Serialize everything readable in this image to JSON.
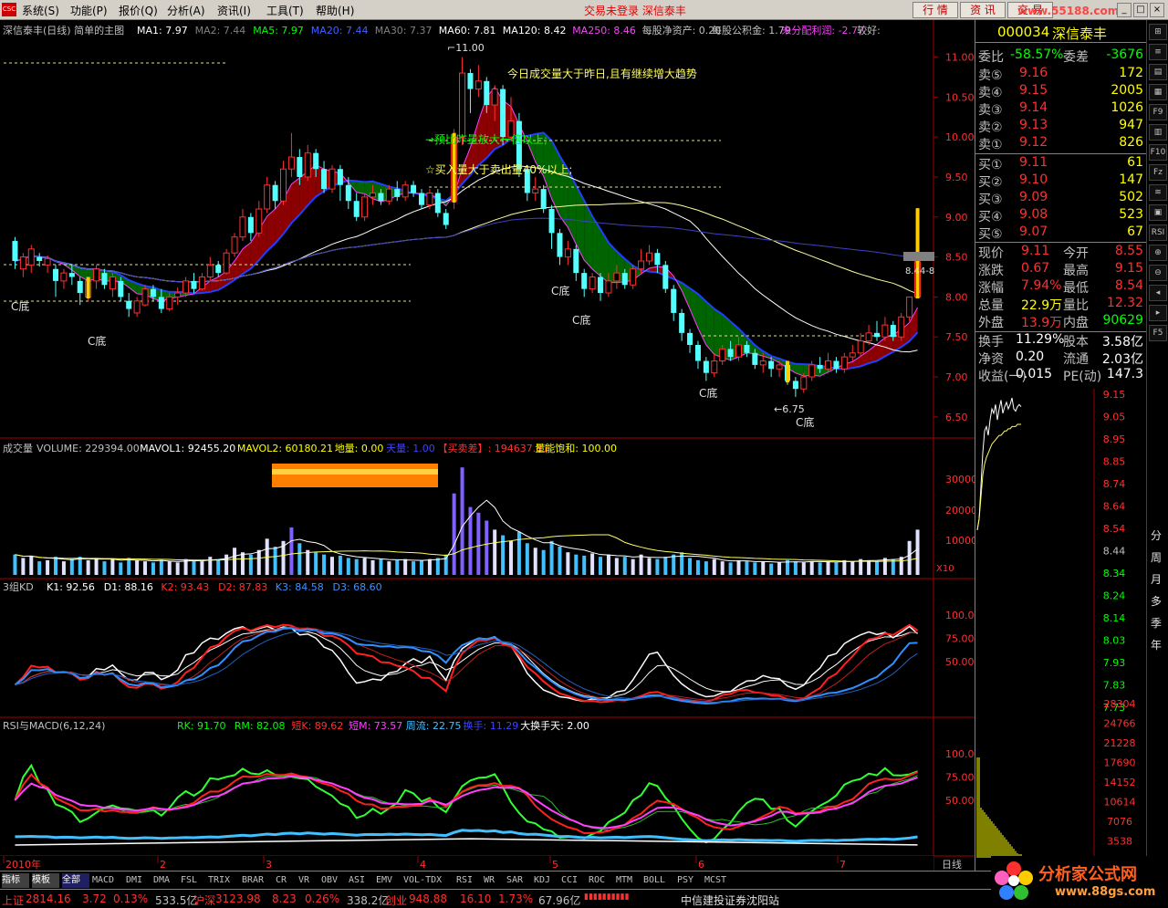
{
  "menu": {
    "items": [
      "系统(S)",
      "功能(P)",
      "报价(Q)",
      "分析(A)",
      "资讯(I)",
      "工具(T)",
      "帮助(H)"
    ],
    "alert": "交易未登录 深信泰丰",
    "buttons": [
      "行 情",
      "资 讯",
      "交 易"
    ],
    "watermark": "www.55188.com"
  },
  "main": {
    "title": "深信泰丰(日线) 简单的主图",
    "ma": [
      {
        "label": "MA1: 7.97",
        "color": "#ffffff"
      },
      {
        "label": "MA2: 7.44",
        "color": "#808080"
      },
      {
        "label": "MA5: 7.97",
        "color": "#00ff00"
      },
      {
        "label": "MA20: 7.44",
        "color": "#4060ff"
      },
      {
        "label": "MA30: 7.37",
        "color": "#808080"
      },
      {
        "label": "MA60: 7.81",
        "color": "#ffffff"
      },
      {
        "label": "MA120: 8.42",
        "color": "#ffffff"
      },
      {
        "label": "MA250: 8.46",
        "color": "#ff40ff"
      },
      {
        "label": "每股净资产: 0.20",
        "color": "#c0c0c0"
      },
      {
        "label": "每股公积金: 1.79",
        "color": "#c0c0c0"
      },
      {
        "label": "未分配利润: -2.77",
        "color": "#ff40ff"
      },
      {
        "label": "较好:",
        "color": "#c0c0c0"
      }
    ],
    "annotations": {
      "trend": "今日成交量大于昨日,且有继续增大趋势",
      "vol_double": "→预比昨量放大一倍以上;",
      "buy_more": "☆买入量大于卖出量40%以上;",
      "high": "11.00",
      "low": "←6.75",
      "current": "8.44-8",
      "cbottom": "C底"
    },
    "price_ticks": [
      "11.00",
      "10.50",
      "10.00",
      "9.50",
      "9.00",
      "8.50",
      "8.00",
      "7.50",
      "7.00",
      "6.50"
    ],
    "candles": [
      [
        8.7,
        8.45,
        8.75,
        8.35
      ],
      [
        8.35,
        8.5,
        8.55,
        8.25
      ],
      [
        8.4,
        8.6,
        8.65,
        8.3
      ],
      [
        8.5,
        8.45,
        8.55,
        8.38
      ],
      [
        8.4,
        8.48,
        8.52,
        8.3
      ],
      [
        8.35,
        8.2,
        8.4,
        8.0
      ],
      [
        8.2,
        8.3,
        8.35,
        8.1
      ],
      [
        8.3,
        8.25,
        8.4,
        8.15
      ],
      [
        8.2,
        8.05,
        8.25,
        7.9
      ],
      [
        8.0,
        8.2,
        8.25,
        7.95
      ],
      [
        8.2,
        8.35,
        8.4,
        8.1
      ],
      [
        8.3,
        8.15,
        8.35,
        8.1
      ],
      [
        8.1,
        8.25,
        8.3,
        8.0
      ],
      [
        8.2,
        8.0,
        8.25,
        7.95
      ],
      [
        7.95,
        7.85,
        8.05,
        7.75
      ],
      [
        7.8,
        7.95,
        8.0,
        7.75
      ],
      [
        7.9,
        8.1,
        8.15,
        7.88
      ],
      [
        8.1,
        8.0,
        8.15,
        7.95
      ],
      [
        8.0,
        7.85,
        8.1,
        7.8
      ],
      [
        7.85,
        8.0,
        8.05,
        7.82
      ],
      [
        8.0,
        8.05,
        8.12,
        7.9
      ],
      [
        8.05,
        8.2,
        8.25,
        8.0
      ],
      [
        8.2,
        8.1,
        8.3,
        8.05
      ],
      [
        8.1,
        8.25,
        8.3,
        8.08
      ],
      [
        8.25,
        8.4,
        8.5,
        8.2
      ],
      [
        8.4,
        8.3,
        8.45,
        8.25
      ],
      [
        8.3,
        8.55,
        8.6,
        8.28
      ],
      [
        8.55,
        8.75,
        8.8,
        8.5
      ],
      [
        8.75,
        9.0,
        9.1,
        8.7
      ],
      [
        9.0,
        8.8,
        9.05,
        8.7
      ],
      [
        8.8,
        9.1,
        9.2,
        8.75
      ],
      [
        9.1,
        9.4,
        9.5,
        9.05
      ],
      [
        9.4,
        9.2,
        9.45,
        9.1
      ],
      [
        9.2,
        9.6,
        9.7,
        9.15
      ],
      [
        9.6,
        9.75,
        10.05,
        9.5
      ],
      [
        9.75,
        9.5,
        9.85,
        9.4
      ],
      [
        9.5,
        9.8,
        9.9,
        9.45
      ],
      [
        9.8,
        9.6,
        9.85,
        9.5
      ],
      [
        9.6,
        9.35,
        9.7,
        9.3
      ],
      [
        9.35,
        9.6,
        9.65,
        9.3
      ],
      [
        9.6,
        9.4,
        9.65,
        9.2
      ],
      [
        9.4,
        9.2,
        9.5,
        9.1
      ],
      [
        9.2,
        9.0,
        9.3,
        8.95
      ],
      [
        9.0,
        9.25,
        9.3,
        8.95
      ],
      [
        9.25,
        9.3,
        9.4,
        9.15
      ],
      [
        9.3,
        9.2,
        9.35,
        9.15
      ],
      [
        9.2,
        9.35,
        9.4,
        9.15
      ],
      [
        9.35,
        9.25,
        9.45,
        9.2
      ],
      [
        9.25,
        9.4,
        9.45,
        9.2
      ],
      [
        9.4,
        9.3,
        9.45,
        9.25
      ],
      [
        9.3,
        9.15,
        9.35,
        9.1
      ],
      [
        9.15,
        9.3,
        9.35,
        9.1
      ],
      [
        9.3,
        9.05,
        9.35,
        9.0
      ],
      [
        9.05,
        8.9,
        9.1,
        8.85
      ],
      [
        9.2,
        10.0,
        10.1,
        9.1
      ],
      [
        10.0,
        10.8,
        11.0,
        9.9
      ],
      [
        10.8,
        10.6,
        10.85,
        10.3
      ],
      [
        10.6,
        10.7,
        10.9,
        10.5
      ],
      [
        10.7,
        10.4,
        10.75,
        10.3
      ],
      [
        10.4,
        10.6,
        10.65,
        10.2
      ],
      [
        10.6,
        10.0,
        10.65,
        9.9
      ],
      [
        10.0,
        10.2,
        10.5,
        9.95
      ],
      [
        10.2,
        9.6,
        10.3,
        9.5
      ],
      [
        9.6,
        9.3,
        9.65,
        9.2
      ],
      [
        9.3,
        9.35,
        9.5,
        9.2
      ],
      [
        9.35,
        9.1,
        9.4,
        9.05
      ],
      [
        9.1,
        8.8,
        9.15,
        8.6
      ],
      [
        8.8,
        8.5,
        8.85,
        8.4
      ],
      [
        8.5,
        8.6,
        8.7,
        8.4
      ],
      [
        8.6,
        8.3,
        8.65,
        8.2
      ],
      [
        8.3,
        8.1,
        8.35,
        8.0
      ],
      [
        8.1,
        8.25,
        8.3,
        8.05
      ],
      [
        8.25,
        8.05,
        8.3,
        7.95
      ],
      [
        8.05,
        8.2,
        8.3,
        8.0
      ],
      [
        8.2,
        8.3,
        8.4,
        8.1
      ],
      [
        8.3,
        8.15,
        8.35,
        8.1
      ],
      [
        8.15,
        8.35,
        8.4,
        8.1
      ],
      [
        8.35,
        8.45,
        8.6,
        8.3
      ],
      [
        8.45,
        8.55,
        8.65,
        8.4
      ],
      [
        8.55,
        8.4,
        8.6,
        8.3
      ],
      [
        8.4,
        8.1,
        8.45,
        8.05
      ],
      [
        8.1,
        7.8,
        8.15,
        7.7
      ],
      [
        7.8,
        7.55,
        7.85,
        7.45
      ],
      [
        7.55,
        7.4,
        7.6,
        7.3
      ],
      [
        7.4,
        7.2,
        7.45,
        7.1
      ],
      [
        7.2,
        7.05,
        7.25,
        6.95
      ],
      [
        7.05,
        7.2,
        7.3,
        7.0
      ],
      [
        7.2,
        7.35,
        7.4,
        7.15
      ],
      [
        7.35,
        7.25,
        7.45,
        7.2
      ],
      [
        7.25,
        7.4,
        7.5,
        7.2
      ],
      [
        7.4,
        7.3,
        7.45,
        7.25
      ],
      [
        7.3,
        7.15,
        7.35,
        7.1
      ],
      [
        7.15,
        7.2,
        7.3,
        7.05
      ],
      [
        7.2,
        7.1,
        7.25,
        7.0
      ],
      [
        7.1,
        7.15,
        7.2,
        7.0
      ],
      [
        7.15,
        6.95,
        7.2,
        6.9
      ],
      [
        6.95,
        6.85,
        7.0,
        6.75
      ],
      [
        6.85,
        7.0,
        7.05,
        6.8
      ],
      [
        7.0,
        7.15,
        7.2,
        6.95
      ],
      [
        7.15,
        7.1,
        7.25,
        7.05
      ],
      [
        7.1,
        7.2,
        7.3,
        7.05
      ],
      [
        7.2,
        7.1,
        7.25,
        7.05
      ],
      [
        7.1,
        7.25,
        7.3,
        7.05
      ],
      [
        7.25,
        7.3,
        7.4,
        7.2
      ],
      [
        7.3,
        7.45,
        7.55,
        7.25
      ],
      [
        7.45,
        7.55,
        7.65,
        7.4
      ],
      [
        7.55,
        7.5,
        7.7,
        7.45
      ],
      [
        7.5,
        7.65,
        7.75,
        7.45
      ],
      [
        7.65,
        7.5,
        7.7,
        7.45
      ],
      [
        7.5,
        7.75,
        7.8,
        7.45
      ],
      [
        7.75,
        8.0,
        8.0,
        7.7
      ],
      [
        8.0,
        8.44,
        9.11,
        8.0
      ]
    ],
    "volumes": [
      18,
      15,
      17,
      12,
      13,
      16,
      12,
      14,
      16,
      13,
      15,
      12,
      14,
      11,
      15,
      13,
      12,
      11,
      13,
      12,
      11,
      14,
      13,
      12,
      16,
      13,
      18,
      24,
      20,
      18,
      22,
      32,
      25,
      30,
      42,
      28,
      22,
      20,
      18,
      16,
      17,
      15,
      14,
      15,
      13,
      14,
      12,
      13,
      14,
      12,
      13,
      14,
      15,
      18,
      72,
      95,
      60,
      55,
      48,
      40,
      35,
      30,
      38,
      28,
      24,
      22,
      30,
      25,
      20,
      18,
      17,
      19,
      16,
      18,
      15,
      16,
      14,
      18,
      15,
      14,
      16,
      18,
      20,
      15,
      13,
      12,
      14,
      12,
      11,
      13,
      12,
      11,
      12,
      10,
      11,
      13,
      12,
      11,
      12,
      11,
      12,
      11,
      13,
      12,
      14,
      13,
      12,
      15,
      14,
      16,
      30,
      40
    ]
  },
  "volume_panel": {
    "label": "成交量",
    "items": [
      {
        "label": "VOLUME: 229394.00",
        "color": "#c0c0c0"
      },
      {
        "label": "MAVOL1: 92455.20",
        "color": "#ffffff"
      },
      {
        "label": "MAVOL2: 60180.21",
        "color": "#ffff00"
      },
      {
        "label": "地量: 0.00",
        "color": "#ffff00"
      },
      {
        "label": "天量: 1.00",
        "color": "#4040ff"
      },
      {
        "label": "【买卖差】: 194637.81",
        "color": "#ff3030"
      },
      {
        "label": "量能饱和: 100.00",
        "color": "#ffff00"
      }
    ],
    "ticks": [
      "30000",
      "20000",
      "10000"
    ],
    "scale": "X10"
  },
  "kd_panel": {
    "label": "3组KD",
    "items": [
      {
        "label": "K1: 92.56",
        "color": "#ffffff"
      },
      {
        "label": "D1: 88.16",
        "color": "#ffffff"
      },
      {
        "label": "K2: 93.43",
        "color": "#ff3030"
      },
      {
        "label": "D2: 87.83",
        "color": "#ff3030"
      },
      {
        "label": "K3: 84.58",
        "color": "#4090ff"
      },
      {
        "label": "D3: 68.60",
        "color": "#4090ff"
      }
    ],
    "ticks": [
      "100.0",
      "75.00",
      "50.00"
    ]
  },
  "rsi_panel": {
    "label": "RSI与MACD(6,12,24)",
    "items": [
      {
        "label": "RK: 91.70",
        "color": "#00ff00"
      },
      {
        "label": "RM: 82.08",
        "color": "#00ff00"
      },
      {
        "label": "短K: 89.62",
        "color": "#ff3030"
      },
      {
        "label": "短M: 73.57",
        "color": "#ff40ff"
      },
      {
        "label": "周流: 22.75",
        "color": "#40c0ff"
      },
      {
        "label": "换手: 11.29",
        "color": "#4040ff"
      },
      {
        "label": "大换手天: 2.00",
        "color": "#ffffff"
      }
    ],
    "ticks": [
      "100.0",
      "75.00",
      "50.00"
    ]
  },
  "date_axis": {
    "labels": [
      "2010年",
      "2",
      "3",
      "4",
      "5",
      "6",
      "7"
    ],
    "period": "日线"
  },
  "quote": {
    "code": "000034",
    "name": "深信泰丰",
    "ratio_label": "委比",
    "ratio": "-58.57%",
    "diff_label": "委差",
    "diff": "-3676",
    "asks": [
      {
        "label": "卖⑤",
        "price": "9.16",
        "vol": "172"
      },
      {
        "label": "卖④",
        "price": "9.15",
        "vol": "2005"
      },
      {
        "label": "卖③",
        "price": "9.14",
        "vol": "1026"
      },
      {
        "label": "卖②",
        "price": "9.13",
        "vol": "947"
      },
      {
        "label": "卖①",
        "price": "9.12",
        "vol": "826"
      }
    ],
    "bids": [
      {
        "label": "买①",
        "price": "9.11",
        "vol": "61"
      },
      {
        "label": "买②",
        "price": "9.10",
        "vol": "147"
      },
      {
        "label": "买③",
        "price": "9.09",
        "vol": "502"
      },
      {
        "label": "买④",
        "price": "9.08",
        "vol": "523"
      },
      {
        "label": "买⑤",
        "price": "9.07",
        "vol": "67"
      }
    ],
    "stats": [
      [
        {
          "t": "现价",
          "c": "#c0c0c0"
        },
        {
          "t": "9.11",
          "c": "#ff3030"
        },
        {
          "t": "今开",
          "c": "#c0c0c0"
        },
        {
          "t": "8.55",
          "c": "#ff3030"
        }
      ],
      [
        {
          "t": "涨跌",
          "c": "#c0c0c0"
        },
        {
          "t": "0.67",
          "c": "#ff3030"
        },
        {
          "t": "最高",
          "c": "#c0c0c0"
        },
        {
          "t": "9.15",
          "c": "#ff3030"
        }
      ],
      [
        {
          "t": "涨幅",
          "c": "#c0c0c0"
        },
        {
          "t": "7.94%",
          "c": "#ff3030"
        },
        {
          "t": "最低",
          "c": "#c0c0c0"
        },
        {
          "t": "8.54",
          "c": "#ff3030"
        }
      ],
      [
        {
          "t": "总量",
          "c": "#c0c0c0"
        },
        {
          "t": "22.9万",
          "c": "#ffff00"
        },
        {
          "t": "量比",
          "c": "#c0c0c0"
        },
        {
          "t": "12.32",
          "c": "#ff3030"
        }
      ],
      [
        {
          "t": "外盘",
          "c": "#c0c0c0"
        },
        {
          "t": "13.9万",
          "c": "#ff3030"
        },
        {
          "t": "内盘",
          "c": "#c0c0c0"
        },
        {
          "t": "90629",
          "c": "#00ff00"
        }
      ]
    ],
    "stats2": [
      [
        {
          "t": "换手",
          "c": "#c0c0c0"
        },
        {
          "t": "11.29%",
          "c": "#ffffff"
        },
        {
          "t": "股本",
          "c": "#c0c0c0"
        },
        {
          "t": "3.58亿",
          "c": "#ffffff"
        }
      ],
      [
        {
          "t": "净资",
          "c": "#c0c0c0"
        },
        {
          "t": "0.20",
          "c": "#ffffff"
        },
        {
          "t": "流通",
          "c": "#c0c0c0"
        },
        {
          "t": "2.03亿",
          "c": "#ffffff"
        }
      ],
      [
        {
          "t": "收益(一)",
          "c": "#c0c0c0"
        },
        {
          "t": "0.015",
          "c": "#ffffff"
        },
        {
          "t": "PE(动)",
          "c": "#c0c0c0"
        },
        {
          "t": "147.3",
          "c": "#ffffff"
        }
      ]
    ],
    "intraday_ticks": [
      {
        "t": "9.15",
        "c": "#ff3030"
      },
      {
        "t": "9.05",
        "c": "#ff3030"
      },
      {
        "t": "8.95",
        "c": "#ff3030"
      },
      {
        "t": "8.85",
        "c": "#ff3030"
      },
      {
        "t": "8.74",
        "c": "#ff3030"
      },
      {
        "t": "8.64",
        "c": "#ff3030"
      },
      {
        "t": "8.54",
        "c": "#ff3030"
      },
      {
        "t": "8.44",
        "c": "#c0c0c0"
      },
      {
        "t": "8.34",
        "c": "#00ff00"
      },
      {
        "t": "8.24",
        "c": "#00ff00"
      },
      {
        "t": "8.14",
        "c": "#00ff00"
      },
      {
        "t": "8.03",
        "c": "#00ff00"
      },
      {
        "t": "7.93",
        "c": "#00ff00"
      },
      {
        "t": "7.83",
        "c": "#00ff00"
      },
      {
        "t": "7.73",
        "c": "#00ff00"
      }
    ],
    "intraday_vol_ticks": [
      "28304",
      "24766",
      "21228",
      "17690",
      "14152",
      "10614",
      "7076",
      "3538"
    ],
    "intraday_prices": [
      8.55,
      8.6,
      8.75,
      8.9,
      9.0,
      9.02,
      8.98,
      9.05,
      9.1,
      9.08,
      9.12,
      9.05,
      9.1,
      9.14,
      9.08,
      9.11,
      9.13,
      9.1,
      9.12,
      9.15,
      9.1,
      9.09,
      9.11,
      9.12,
      9.11
    ],
    "intraday_avg": [
      8.55,
      8.6,
      8.7,
      8.8,
      8.85,
      8.88,
      8.9,
      8.92,
      8.94,
      8.95,
      8.96,
      8.97,
      8.98,
      8.98,
      8.99,
      9.0,
      9.0,
      9.01,
      9.01,
      9.02,
      9.02,
      9.02,
      9.03,
      9.03,
      9.03
    ]
  },
  "right_toolbar": {
    "buttons": [
      "⊞",
      "≡",
      "▤",
      "▦",
      "F9",
      "▥",
      "F10",
      "Fz",
      "≋",
      "▣",
      "RSI",
      "⊕",
      "⊖",
      "◂",
      "▸",
      "F5"
    ],
    "periods": [
      "分",
      "周",
      "月",
      "多",
      "季",
      "年"
    ]
  },
  "tabs": [
    "指标",
    "模板",
    "全部",
    "MACD",
    "DMI",
    "DMA",
    "FSL",
    "TRIX",
    "BRAR",
    "CR",
    "VR",
    "OBV",
    "ASI",
    "EMV",
    "VOL-TDX",
    "RSI",
    "WR",
    "SAR",
    "KDJ",
    "CCI",
    "ROC",
    "MTM",
    "BOLL",
    "PSY",
    "MCST"
  ],
  "status": {
    "sh_label": "上证",
    "sh_index": "2814.16",
    "sh_change": "3.72",
    "sh_pct": "0.13%",
    "sh_amount": "533.5亿",
    "sz_label": "沪深",
    "sz_index": "3123.98",
    "sz_change": "8.23",
    "sz_pct": "0.26%",
    "sz_amount": "338.2亿",
    "cy_label": "创业",
    "cy_index": "948.88",
    "cy_change": "16.10",
    "cy_pct": "1.73%",
    "cy_amount": "67.96亿",
    "broker": "中信建投证券沈阳站"
  },
  "logo": {
    "text": "分析家公式网",
    "url": "www.88gs.com"
  }
}
